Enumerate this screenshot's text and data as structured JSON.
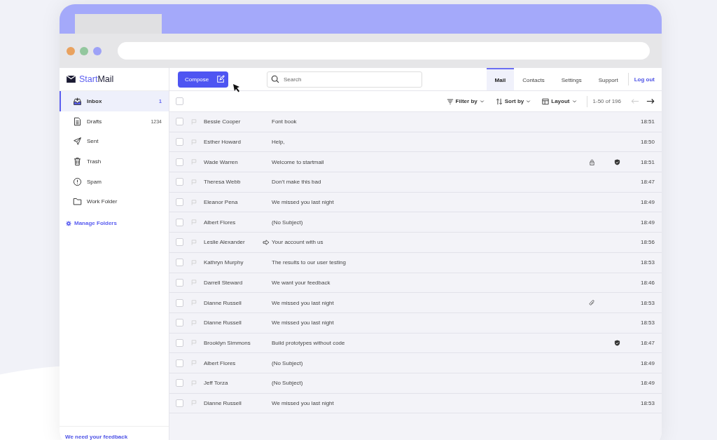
{
  "logo": {
    "part1": "Start",
    "part2": "Mail"
  },
  "compose": {
    "label": "Compose"
  },
  "search": {
    "placeholder": "Search"
  },
  "nav": [
    {
      "label": "Mail",
      "selected": true
    },
    {
      "label": "Contacts",
      "selected": false
    },
    {
      "label": "Settings",
      "selected": false
    },
    {
      "label": "Support",
      "selected": false
    }
  ],
  "logout": "Log out",
  "folders": [
    {
      "label": "Inbox",
      "count": "1",
      "selected": true
    },
    {
      "label": "Drafts",
      "count": "1234",
      "selected": false
    },
    {
      "label": "Sent",
      "selected": false
    },
    {
      "label": "Trash",
      "selected": false
    },
    {
      "label": "Spam",
      "selected": false
    },
    {
      "label": "Work Folder",
      "selected": false
    }
  ],
  "manage_folders": "Manage Folders",
  "feedback": "We need your feedback",
  "toolbar": {
    "select_all_checked": false,
    "filter": "Filter by",
    "sort": "Sort by",
    "layout": "Layout",
    "range": "1-50 of 196"
  },
  "messages": [
    {
      "sender": "Bessie Cooper",
      "subject": "Font book",
      "time": "18:51",
      "checked": false,
      "flagged": false,
      "forwarded": false,
      "locked": false,
      "verified": false,
      "attachment": false
    },
    {
      "sender": "Esther Howard",
      "subject": "Help,",
      "time": "18:50",
      "checked": false,
      "flagged": false,
      "forwarded": false,
      "locked": false,
      "verified": false,
      "attachment": false
    },
    {
      "sender": "Wade Warren",
      "subject": "Welcome to startmail",
      "time": "18:51",
      "checked": false,
      "flagged": false,
      "forwarded": false,
      "locked": true,
      "verified": true,
      "attachment": false
    },
    {
      "sender": "Theresa Webb",
      "subject": "Don't make this bad",
      "time": "18:47",
      "checked": false,
      "flagged": false,
      "forwarded": false,
      "locked": false,
      "verified": false,
      "attachment": false
    },
    {
      "sender": "Eleanor Pena",
      "subject": "We missed you last night",
      "time": "18:49",
      "checked": false,
      "flagged": false,
      "forwarded": false,
      "locked": false,
      "verified": false,
      "attachment": false
    },
    {
      "sender": "Albert Flores",
      "subject": "(No Subject)",
      "time": "18:49",
      "checked": false,
      "flagged": false,
      "forwarded": false,
      "locked": false,
      "verified": false,
      "attachment": false
    },
    {
      "sender": "Leslie Alexander",
      "subject": "Your account with us",
      "time": "18:56",
      "checked": false,
      "flagged": false,
      "forwarded": true,
      "locked": false,
      "verified": false,
      "attachment": false
    },
    {
      "sender": "Kathryn Murphy",
      "subject": "The results to our user testing",
      "time": "18:53",
      "checked": false,
      "flagged": false,
      "forwarded": false,
      "locked": false,
      "verified": false,
      "attachment": false
    },
    {
      "sender": "Darrell Steward",
      "subject": "We want your feedback",
      "time": "18:46",
      "checked": false,
      "flagged": false,
      "forwarded": false,
      "locked": false,
      "verified": false,
      "attachment": false
    },
    {
      "sender": "Dianne Russell",
      "subject": "We missed you last night",
      "time": "18:53",
      "checked": false,
      "flagged": false,
      "forwarded": false,
      "locked": false,
      "verified": false,
      "attachment": true
    },
    {
      "sender": "Dianne Russell",
      "subject": "We missed you last night",
      "time": "18:53",
      "checked": false,
      "flagged": false,
      "forwarded": false,
      "locked": false,
      "verified": false,
      "attachment": false
    },
    {
      "sender": "Brooklyn Simmons",
      "subject": "Build prototypes without code",
      "time": "18:47",
      "checked": false,
      "flagged": false,
      "forwarded": false,
      "locked": false,
      "verified": true,
      "attachment": false
    },
    {
      "sender": "Albert Flores",
      "subject": "(No Subject)",
      "time": "18:49",
      "checked": false,
      "flagged": false,
      "forwarded": false,
      "locked": false,
      "verified": false,
      "attachment": false
    },
    {
      "sender": "Jeff Torza",
      "subject": "(No Subject)",
      "time": "18:49",
      "checked": false,
      "flagged": false,
      "forwarded": false,
      "locked": false,
      "verified": false,
      "attachment": false
    },
    {
      "sender": "Dianne Russell",
      "subject": "We missed you last night",
      "time": "18:53",
      "checked": false,
      "flagged": false,
      "forwarded": false,
      "locked": false,
      "verified": false,
      "attachment": false
    }
  ]
}
